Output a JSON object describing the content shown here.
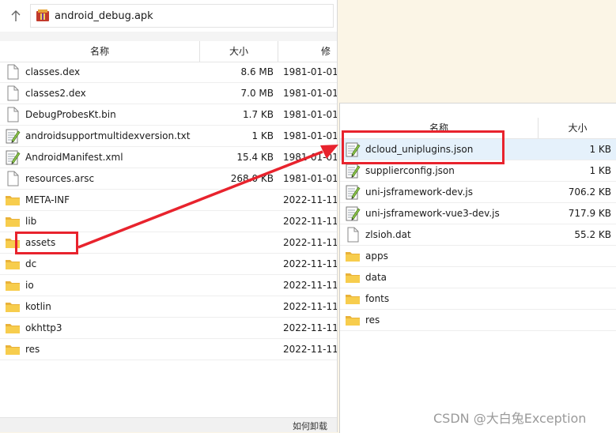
{
  "left": {
    "path_label": "android_debug.apk",
    "headers": {
      "name": "名称",
      "size": "大小",
      "modified": "修"
    },
    "files": [
      {
        "name": "classes.dex",
        "size": "8.6 MB",
        "date": "1981-01-01",
        "icon": "file-icon"
      },
      {
        "name": "classes2.dex",
        "size": "7.0 MB",
        "date": "1981-01-01",
        "icon": "file-icon"
      },
      {
        "name": "DebugProbesKt.bin",
        "size": "1.7 KB",
        "date": "1981-01-01",
        "icon": "file-icon"
      },
      {
        "name": "androidsupportmultidexversion.txt",
        "size": "1 KB",
        "date": "1981-01-01",
        "icon": "text-file-icon"
      },
      {
        "name": "AndroidManifest.xml",
        "size": "15.4 KB",
        "date": "1981-01-01",
        "icon": "text-file-icon"
      },
      {
        "name": "resources.arsc",
        "size": "268.0 KB",
        "date": "1981-01-01",
        "icon": "file-icon"
      },
      {
        "name": "META-INF",
        "size": "",
        "date": "2022-11-11",
        "icon": "folder-icon"
      },
      {
        "name": "lib",
        "size": "",
        "date": "2022-11-11",
        "icon": "folder-icon"
      },
      {
        "name": "assets",
        "size": "",
        "date": "2022-11-11",
        "icon": "folder-icon"
      },
      {
        "name": "dc",
        "size": "",
        "date": "2022-11-11",
        "icon": "folder-icon"
      },
      {
        "name": "io",
        "size": "",
        "date": "2022-11-11",
        "icon": "folder-icon"
      },
      {
        "name": "kotlin",
        "size": "",
        "date": "2022-11-11",
        "icon": "folder-icon"
      },
      {
        "name": "okhttp3",
        "size": "",
        "date": "2022-11-11",
        "icon": "folder-icon"
      },
      {
        "name": "res",
        "size": "",
        "date": "2022-11-11",
        "icon": "folder-icon"
      }
    ],
    "status_text": "如何卸载"
  },
  "right": {
    "headers": {
      "name": "名称",
      "size": "大小"
    },
    "files": [
      {
        "name": "dcloud_uniplugins.json",
        "size": "1 KB",
        "icon": "text-file-icon"
      },
      {
        "name": "supplierconfig.json",
        "size": "1 KB",
        "icon": "text-file-icon"
      },
      {
        "name": "uni-jsframework-dev.js",
        "size": "706.2 KB",
        "icon": "text-file-icon"
      },
      {
        "name": "uni-jsframework-vue3-dev.js",
        "size": "717.9 KB",
        "icon": "text-file-icon"
      },
      {
        "name": "zlsioh.dat",
        "size": "55.2 KB",
        "icon": "file-icon"
      },
      {
        "name": "apps",
        "size": "",
        "icon": "folder-icon"
      },
      {
        "name": "data",
        "size": "",
        "icon": "folder-icon"
      },
      {
        "name": "fonts",
        "size": "",
        "icon": "folder-icon"
      },
      {
        "name": "res",
        "size": "",
        "icon": "folder-icon"
      }
    ]
  },
  "watermark": "CSDN @大白兔Exception",
  "colors": {
    "annotation_red": "#e8232d",
    "selection": "#e5f1fb",
    "folder": "#f5c342"
  }
}
